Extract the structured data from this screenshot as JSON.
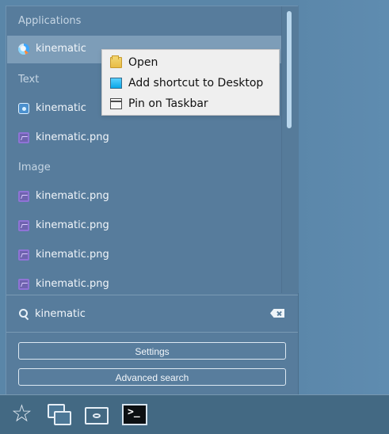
{
  "menu": {
    "section_applications": "Applications",
    "section_text": "Text",
    "section_image": "Image",
    "results": [
      {
        "label": "kinematic",
        "icon": "app-icon"
      },
      {
        "label": "kinematic",
        "icon": "document-icon"
      },
      {
        "label": "kinematic.png",
        "icon": "image-file-icon"
      },
      {
        "label": "kinematic.png",
        "icon": "image-file-icon"
      },
      {
        "label": "kinematic.png",
        "icon": "image-file-icon"
      },
      {
        "label": "kinematic.png",
        "icon": "image-file-icon"
      },
      {
        "label": "kinematic.png",
        "icon": "image-file-icon"
      }
    ],
    "search": {
      "value": "kinematic"
    },
    "settings_label": "Settings",
    "advanced_search_label": "Advanced search"
  },
  "context_menu": {
    "items": [
      {
        "label": "Open",
        "icon": "folder-icon"
      },
      {
        "label": "Add shortcut to Desktop",
        "icon": "desktop-shortcut-icon"
      },
      {
        "label": "Pin on Taskbar",
        "icon": "taskbar-pin-icon"
      }
    ]
  },
  "taskbar": {
    "icons": [
      "star-icon",
      "windows-icon",
      "files-icon",
      "terminal-icon"
    ]
  }
}
